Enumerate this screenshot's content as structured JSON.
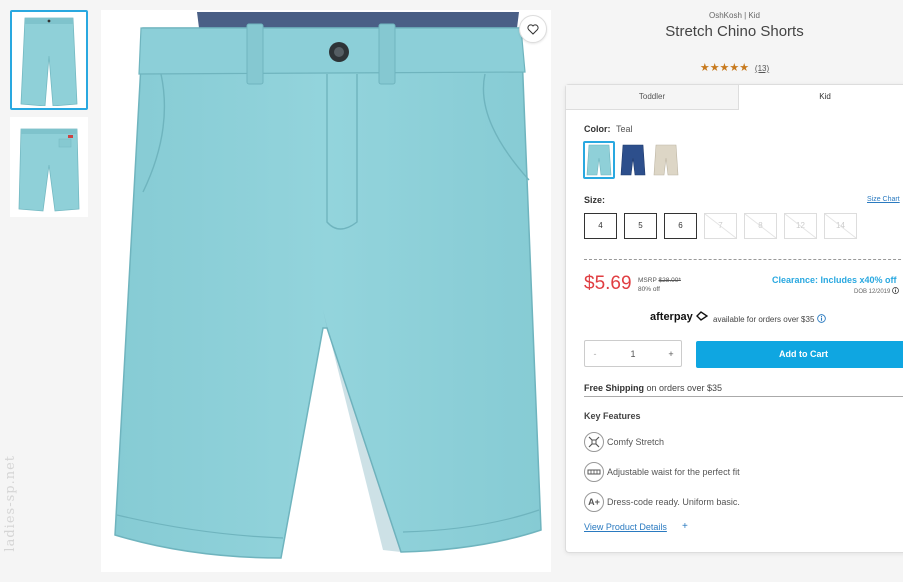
{
  "product": {
    "brand_line": "OshKosh | Kid",
    "title": "Stretch Chino Shorts",
    "stars": "★★★★★",
    "review_count": "(13)"
  },
  "tabs": [
    {
      "label": "Toddler",
      "active": false
    },
    {
      "label": "Kid",
      "active": true
    }
  ],
  "color": {
    "label": "Color:",
    "value": "Teal",
    "swatches": [
      {
        "name": "Teal",
        "hex": "#8fd0d8",
        "selected": true
      },
      {
        "name": "Navy",
        "hex": "#2d4f8c",
        "selected": false
      },
      {
        "name": "Khaki",
        "hex": "#ddd6c6",
        "selected": false
      }
    ]
  },
  "size": {
    "label": "Size:",
    "chart_link": "Size Chart",
    "options": [
      {
        "label": "4",
        "available": true
      },
      {
        "label": "5",
        "available": true
      },
      {
        "label": "6",
        "available": true
      },
      {
        "label": "7",
        "available": false
      },
      {
        "label": "8",
        "available": false
      },
      {
        "label": "12",
        "available": false
      },
      {
        "label": "14",
        "available": false
      }
    ]
  },
  "pricing": {
    "price": "$5.69",
    "msrp_label": "MSRP",
    "msrp_value": "$28.00*",
    "discount": "80% off",
    "clearance": "Clearance: Includes x40% off",
    "dob": "DOB 12/2019"
  },
  "afterpay": {
    "brand": "afterpay",
    "note": "available for orders over $35"
  },
  "quantity": {
    "minus": "-",
    "value": "1",
    "plus": "+"
  },
  "add_to_cart": "Add to Cart",
  "shipping": {
    "bold": "Free Shipping",
    "rest": " on orders over $35"
  },
  "key_features": {
    "title": "Key Features",
    "items": [
      {
        "icon": "stretch-icon",
        "text": "Comfy Stretch"
      },
      {
        "icon": "adjustable-waist-icon",
        "text": "Adjustable waist for the perfect fit"
      },
      {
        "icon": "grade-a-plus-icon",
        "text": "Dress-code ready. Uniform basic."
      }
    ],
    "details_link": "View Product Details",
    "details_plus": "+"
  },
  "watermark": "ladies-sp.net",
  "colors": {
    "accent": "#0fa6e1",
    "price_red": "#e03e42",
    "star": "#c77a1e",
    "teal_fabric": "#8fd0d8"
  }
}
